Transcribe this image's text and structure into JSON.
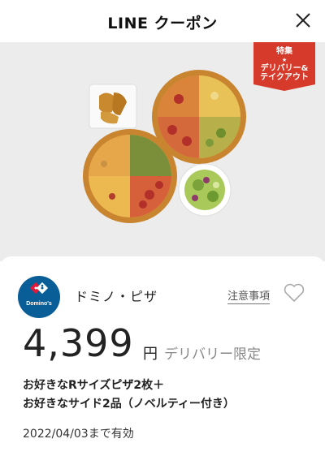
{
  "header": {
    "title": "LINE クーポン"
  },
  "badge": {
    "line1": "特集",
    "line2": "デリバリー&",
    "line3": "テイクアウト",
    "color": "#d63a2a"
  },
  "coupon": {
    "brand_name": "ドミノ・ピザ",
    "logo_text": "Domino's",
    "notes_label": "注意事項",
    "price": "4,399",
    "currency": "円",
    "limitation": "デリバリー限定",
    "description_line1": "お好きなRサイズピザ2枚＋",
    "description_line2": "お好きなサイド2品（ノベルティー付き）",
    "valid_until": "2022/04/03まで有効"
  },
  "colors": {
    "brand_blue": "#0a5e98",
    "brand_red": "#e31837",
    "hero_bg": "#ececec"
  }
}
